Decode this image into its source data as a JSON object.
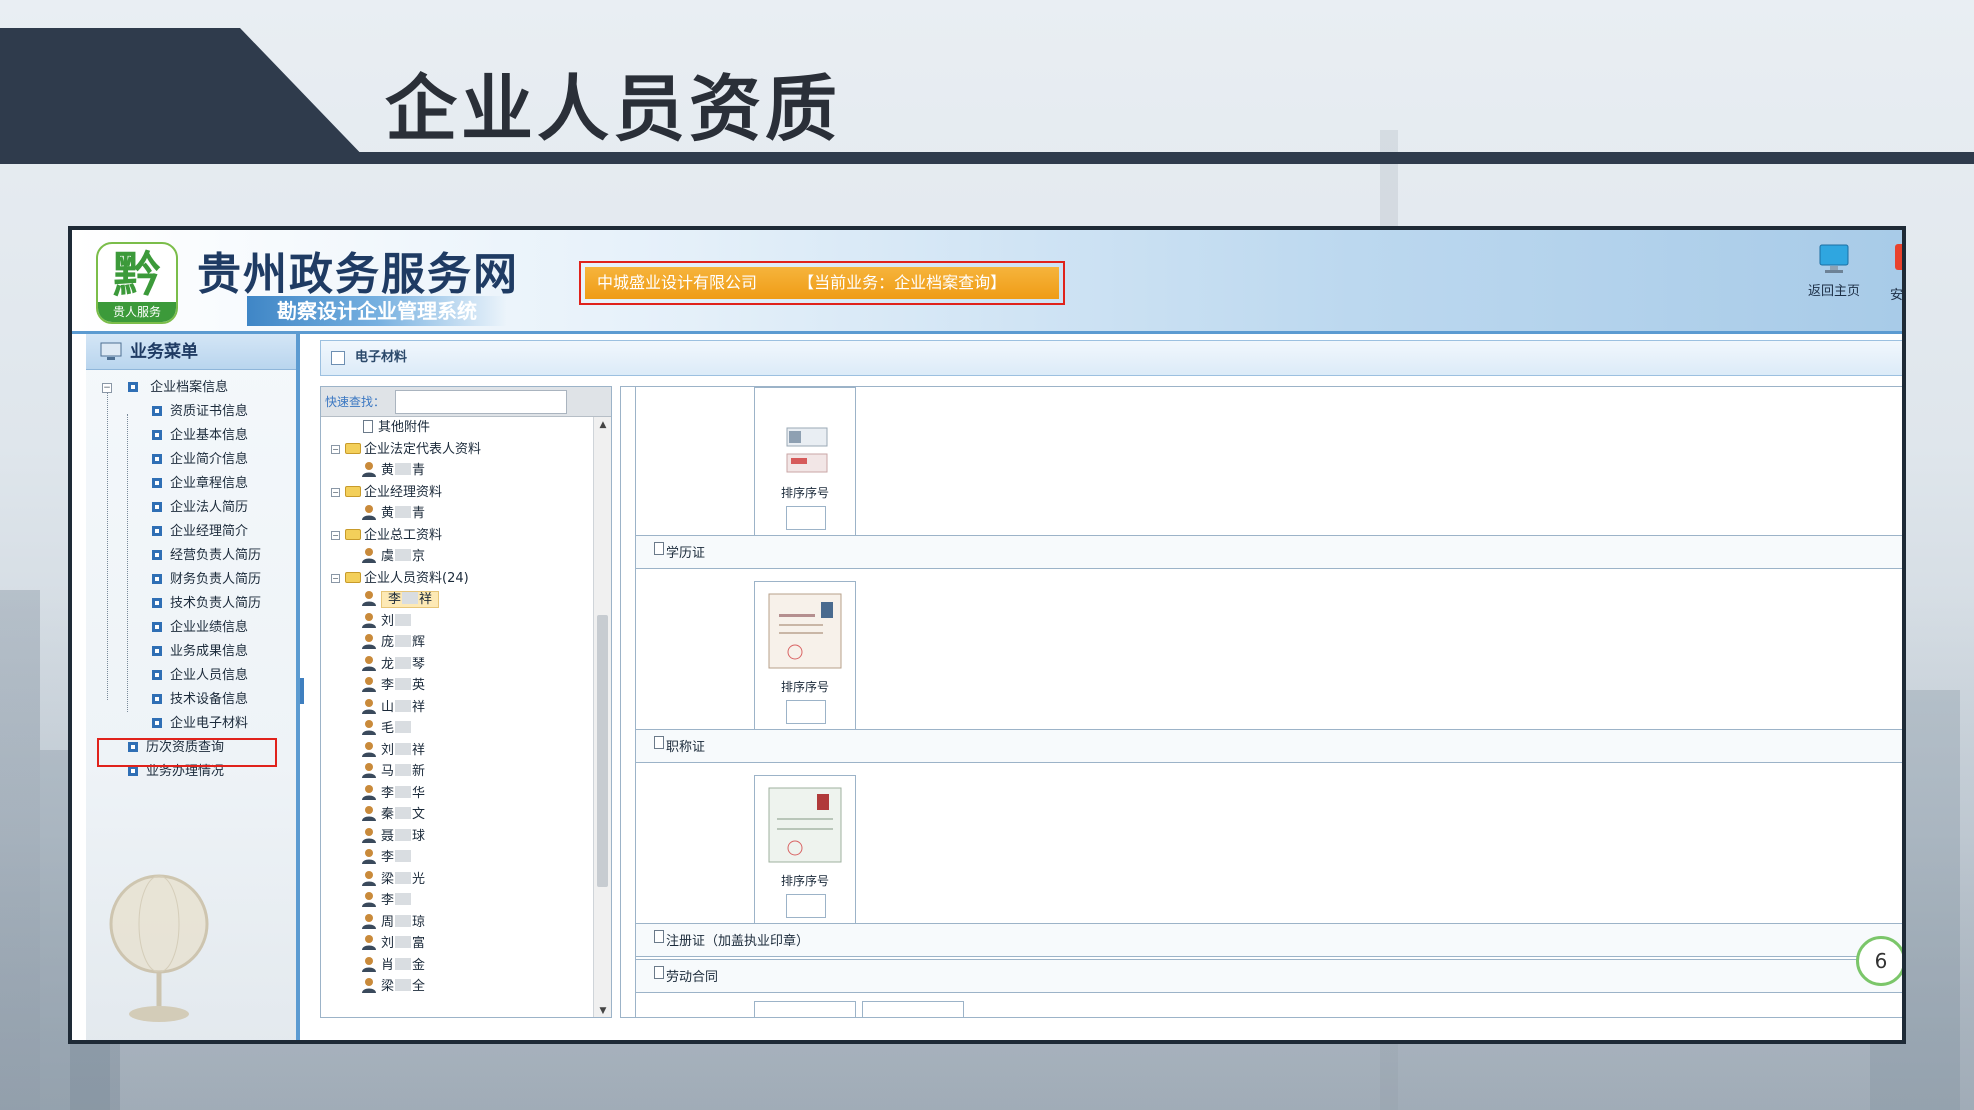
{
  "page": {
    "title": "企业人员资质"
  },
  "header": {
    "logo_glyph": "黔",
    "logo_sub": "贵人服务",
    "site_name": "贵州政务服务网",
    "system_name": "勘察设计企业管理系统",
    "company": "中城盛业设计有限公司",
    "current_business": "【当前业务：企业档案查询】",
    "home_label": "返回主页",
    "cut_label": "安"
  },
  "sidebar": {
    "title": "业务菜单",
    "root": "企业档案信息",
    "items": [
      "资质证书信息",
      "企业基本信息",
      "企业简介信息",
      "企业章程信息",
      "企业法人简历",
      "企业经理简介",
      "经营负责人简历",
      "财务负责人简历",
      "技术负责人简历",
      "企业业绩信息",
      "业务成果信息",
      "企业人员信息",
      "技术设备信息",
      "企业电子材料"
    ],
    "bottom_items": [
      "历次资质查询",
      "业务办理情况"
    ]
  },
  "content": {
    "bar_title": "电子材料",
    "quick_search_label": "快速查找：",
    "tree": [
      {
        "type": "file",
        "label": "其他附件"
      },
      {
        "type": "folder",
        "label": "企业法定代表人资料"
      },
      {
        "type": "person",
        "name_first": "黄",
        "name_last": "青"
      },
      {
        "type": "folder",
        "label": "企业经理资料"
      },
      {
        "type": "person",
        "name_first": "黄",
        "name_last": "青"
      },
      {
        "type": "folder",
        "label": "企业总工资料"
      },
      {
        "type": "person",
        "name_first": "虞",
        "name_last": "京"
      },
      {
        "type": "folder",
        "label": "企业人员资料(24)"
      },
      {
        "type": "person",
        "name_first": "李",
        "name_last": "祥",
        "selected": true
      },
      {
        "type": "person",
        "name_first": "刘",
        "name_last": ""
      },
      {
        "type": "person",
        "name_first": "庞",
        "name_last": "辉"
      },
      {
        "type": "person",
        "name_first": "龙",
        "name_last": "琴"
      },
      {
        "type": "person",
        "name_first": "李",
        "name_last": "英"
      },
      {
        "type": "person",
        "name_first": "山",
        "name_last": "祥"
      },
      {
        "type": "person",
        "name_first": "毛",
        "name_last": ""
      },
      {
        "type": "person",
        "name_first": "刘",
        "name_last": "祥"
      },
      {
        "type": "person",
        "name_first": "马",
        "name_last": "新"
      },
      {
        "type": "person",
        "name_first": "李",
        "name_last": "华"
      },
      {
        "type": "person",
        "name_first": "秦",
        "name_last": "文"
      },
      {
        "type": "person",
        "name_first": "聂",
        "name_last": "球"
      },
      {
        "type": "person",
        "name_first": "李",
        "name_last": ""
      },
      {
        "type": "person",
        "name_first": "梁",
        "name_last": "光"
      },
      {
        "type": "person",
        "name_first": "李",
        "name_last": ""
      },
      {
        "type": "person",
        "name_first": "周",
        "name_last": "琼"
      },
      {
        "type": "person",
        "name_first": "刘",
        "name_last": "富"
      },
      {
        "type": "person",
        "name_first": "肖",
        "name_last": "金"
      },
      {
        "type": "person",
        "name_first": "梁",
        "name_last": "全"
      }
    ],
    "sort_label": "排序序号",
    "sections": [
      "学历证",
      "职称证",
      "注册证（加盖执业印章）",
      "劳动合同"
    ],
    "badge": "6"
  },
  "colors": {
    "banner_dark": "#2f3b4c",
    "accent_blue": "#5c9bd1",
    "highlight_red": "#e0221b",
    "biz_orange": "#ef9c16"
  }
}
